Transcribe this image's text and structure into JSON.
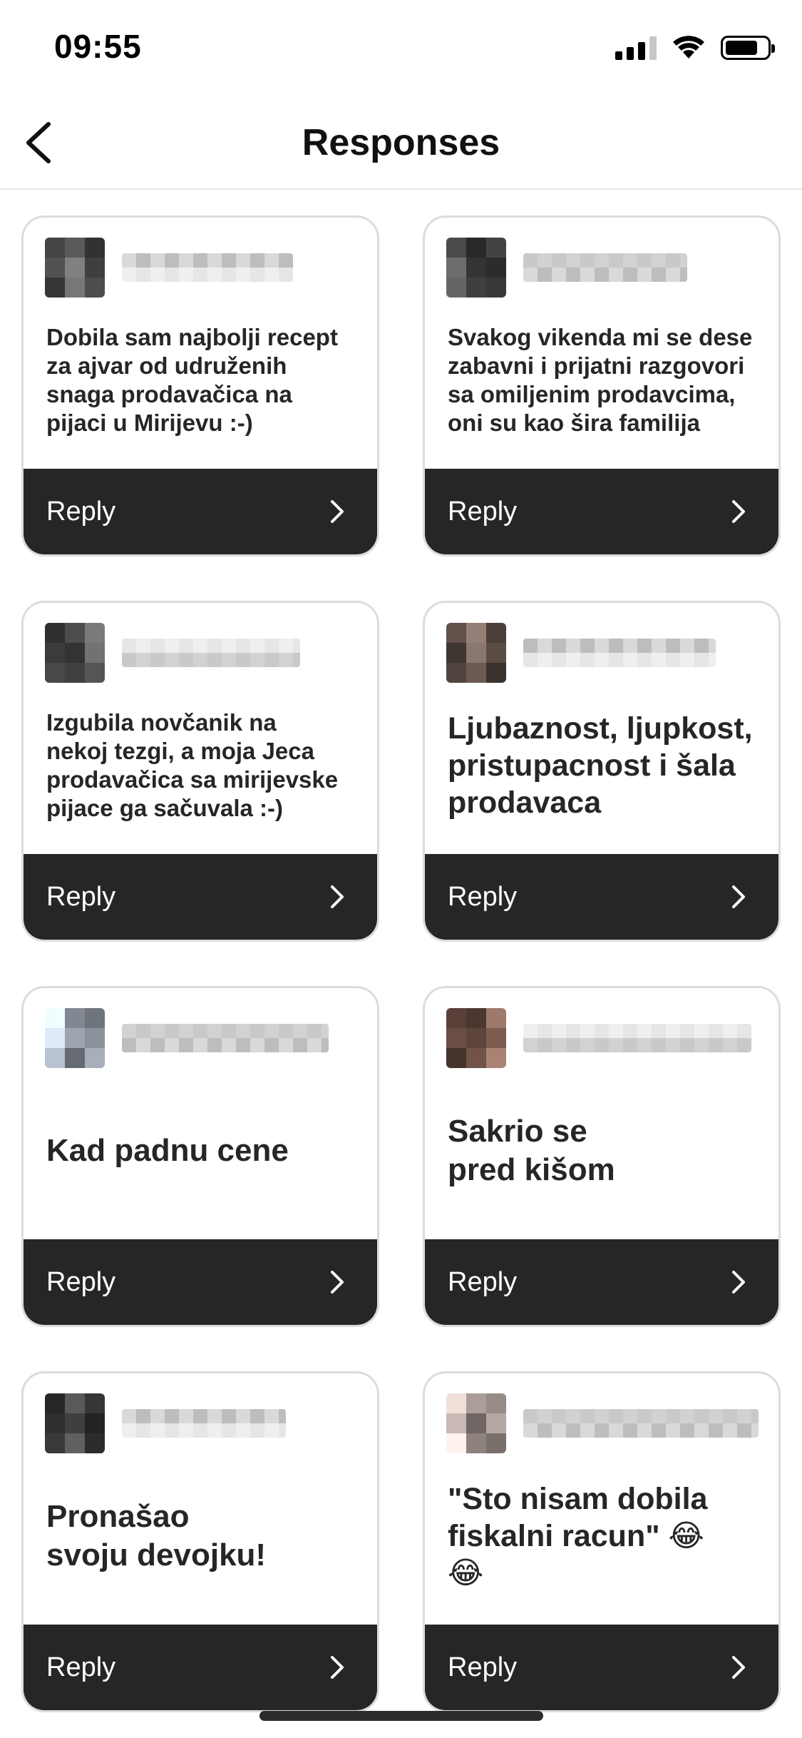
{
  "status_bar": {
    "time": "09:55",
    "icons": [
      "cellular-signal-icon",
      "wifi-icon",
      "battery-icon"
    ]
  },
  "nav": {
    "title": "Responses",
    "back_icon": "chevron-left-icon"
  },
  "responses": [
    {
      "text": "Dobila sam najbolji recept\nza ajvar od udruženih\nsnaga prodavačica na\npijaci u Mirijevu :-)",
      "reply_label": "Reply",
      "avatar_tone": "#5a5a5a",
      "size": "small"
    },
    {
      "text": "Svakog vikenda mi se dese\nzabavni i prijatni razgovori\nsa omiljenim prodavcima,\noni su kao šira familija",
      "reply_label": "Reply",
      "avatar_tone": "#4a4a4a",
      "size": "small"
    },
    {
      "text": "Izgubila novčanik na\nnekoj tezgi, a moja Jeca\nprodavačica sa mirijevske\npijace ga sačuvala :-)",
      "reply_label": "Reply",
      "avatar_tone": "#555555",
      "size": "small"
    },
    {
      "text": "Ljubaznost, ljupkost,\npristupacnost i šala\nprodavaca",
      "reply_label": "Reply",
      "avatar_tone": "#6b5a52",
      "size": "medium"
    },
    {
      "text": "Kad padnu cene",
      "reply_label": "Reply",
      "avatar_tone": "#b9c2d0",
      "size": "large"
    },
    {
      "text": "Sakrio se\npred kišom",
      "reply_label": "Reply",
      "avatar_tone": "#7d5c50",
      "size": "large"
    },
    {
      "text": "Pronašao\nsvoju devojku!",
      "reply_label": "Reply",
      "avatar_tone": "#3f3f3f",
      "size": "large"
    },
    {
      "text": "\"Sto nisam dobila\nfiskalni racun\" 😂\n😂",
      "reply_label": "Reply",
      "avatar_tone": "#c9b9b4",
      "size": "medium"
    }
  ],
  "colors": {
    "reply_bar": "#262626",
    "card_border": "#dcdcdc",
    "text": "#262626"
  }
}
